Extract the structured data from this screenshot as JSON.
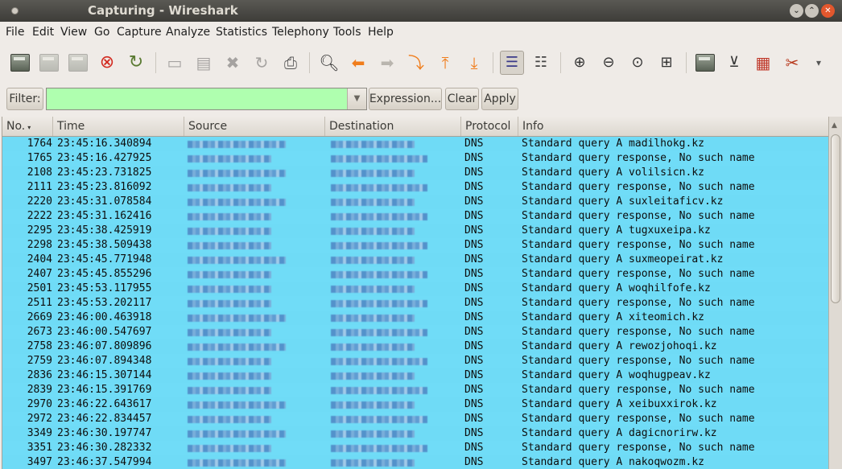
{
  "window": {
    "title": "Capturing - Wireshark"
  },
  "menu": [
    "File",
    "Edit",
    "View",
    "Go",
    "Capture",
    "Analyze",
    "Statistics",
    "Telephony",
    "Tools",
    "Help"
  ],
  "toolbar": {
    "icons": [
      "interfaces-icon",
      "options-icon",
      "start-icon",
      "stop-icon",
      "restart-icon",
      "open-icon",
      "save-icon",
      "close-icon",
      "reload-icon",
      "print-icon",
      "find-icon",
      "back-icon",
      "forward-icon",
      "goto-icon",
      "first-icon",
      "last-icon",
      "colorize-icon",
      "autoscroll-icon",
      "zoom-in-icon",
      "zoom-out-icon",
      "zoom-normal-icon",
      "resize-columns-icon",
      "capture-filters-icon",
      "display-filters-icon",
      "coloring-rules-icon",
      "preferences-icon",
      "more-icon"
    ],
    "more": "▾"
  },
  "filter": {
    "label": "Filter:",
    "value": "",
    "expression": "Expression...",
    "clear": "Clear",
    "apply": "Apply",
    "bg_color": "#afffaf"
  },
  "columns": [
    "No.",
    "Time",
    "Source",
    "Destination",
    "Protocol",
    "Info"
  ],
  "sort_indicator": "▾",
  "row_color": "#70dcf7",
  "packets": [
    {
      "no": "1764",
      "time": "23:45:16.340894",
      "protocol": "DNS",
      "info": "Standard query A madilhokg.kz"
    },
    {
      "no": "1765",
      "time": "23:45:16.427925",
      "protocol": "DNS",
      "info": "Standard query response, No such name"
    },
    {
      "no": "2108",
      "time": "23:45:23.731825",
      "protocol": "DNS",
      "info": "Standard query A volilsicn.kz"
    },
    {
      "no": "2111",
      "time": "23:45:23.816092",
      "protocol": "DNS",
      "info": "Standard query response, No such name"
    },
    {
      "no": "2220",
      "time": "23:45:31.078584",
      "protocol": "DNS",
      "info": "Standard query A suxleitaficv.kz"
    },
    {
      "no": "2222",
      "time": "23:45:31.162416",
      "protocol": "DNS",
      "info": "Standard query response, No such name"
    },
    {
      "no": "2295",
      "time": "23:45:38.425919",
      "protocol": "DNS",
      "info": "Standard query A tugxuxeipa.kz"
    },
    {
      "no": "2298",
      "time": "23:45:38.509438",
      "protocol": "DNS",
      "info": "Standard query response, No such name"
    },
    {
      "no": "2404",
      "time": "23:45:45.771948",
      "protocol": "DNS",
      "info": "Standard query A suxmeopeirat.kz"
    },
    {
      "no": "2407",
      "time": "23:45:45.855296",
      "protocol": "DNS",
      "info": "Standard query response, No such name"
    },
    {
      "no": "2501",
      "time": "23:45:53.117955",
      "protocol": "DNS",
      "info": "Standard query A woqhilfofe.kz"
    },
    {
      "no": "2511",
      "time": "23:45:53.202117",
      "protocol": "DNS",
      "info": "Standard query response, No such name"
    },
    {
      "no": "2669",
      "time": "23:46:00.463918",
      "protocol": "DNS",
      "info": "Standard query A xiteomich.kz"
    },
    {
      "no": "2673",
      "time": "23:46:00.547697",
      "protocol": "DNS",
      "info": "Standard query response, No such name"
    },
    {
      "no": "2758",
      "time": "23:46:07.809896",
      "protocol": "DNS",
      "info": "Standard query A rewozjohoqi.kz"
    },
    {
      "no": "2759",
      "time": "23:46:07.894348",
      "protocol": "DNS",
      "info": "Standard query response, No such name"
    },
    {
      "no": "2836",
      "time": "23:46:15.307144",
      "protocol": "DNS",
      "info": "Standard query A woqhugpeav.kz"
    },
    {
      "no": "2839",
      "time": "23:46:15.391769",
      "protocol": "DNS",
      "info": "Standard query response, No such name"
    },
    {
      "no": "2970",
      "time": "23:46:22.643617",
      "protocol": "DNS",
      "info": "Standard query A xeibuxxirok.kz"
    },
    {
      "no": "2972",
      "time": "23:46:22.834457",
      "protocol": "DNS",
      "info": "Standard query response, No such name"
    },
    {
      "no": "3349",
      "time": "23:46:30.197747",
      "protocol": "DNS",
      "info": "Standard query A dagicnorirw.kz"
    },
    {
      "no": "3351",
      "time": "23:46:30.282332",
      "protocol": "DNS",
      "info": "Standard query response, No such name"
    },
    {
      "no": "3497",
      "time": "23:46:37.547994",
      "protocol": "DNS",
      "info": "Standard query A nakoqwozm.kz"
    }
  ]
}
